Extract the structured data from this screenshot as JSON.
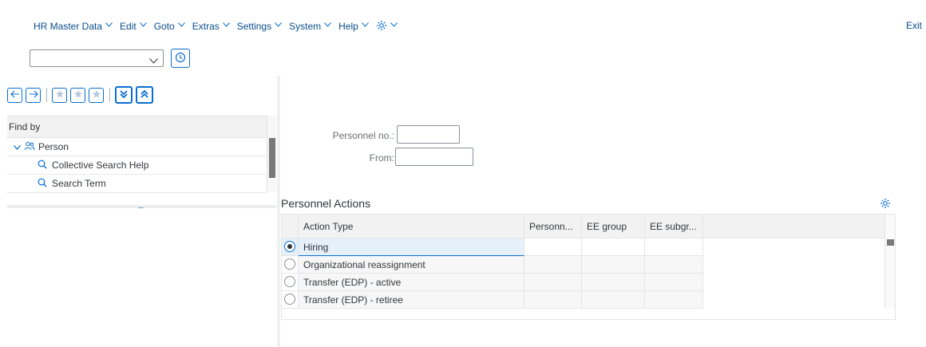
{
  "menubar": {
    "items": [
      "HR Master Data",
      "Edit",
      "Goto",
      "Extras",
      "Settings",
      "System",
      "Help"
    ],
    "settings_icon": "gear-icon",
    "exit_label": "Exit"
  },
  "command_field": {
    "value": "",
    "button_icon": "history-icon"
  },
  "toolbar": {
    "icons": [
      "arrow-left-icon",
      "arrow-right-icon",
      "star-add-icon",
      "star-icon",
      "star-remove-icon",
      "expand-all-icon",
      "collapse-all-icon"
    ]
  },
  "tree": {
    "header": "Find by",
    "items": [
      {
        "label": "Person",
        "icon": "people-icon",
        "expanded": true
      },
      {
        "label": "Collective Search Help",
        "icon": "search-icon"
      },
      {
        "label": "Search Term",
        "icon": "search-icon"
      }
    ],
    "splitter_dots": "....."
  },
  "form": {
    "personnel_no_label": "Personnel no.:",
    "personnel_no_value": "",
    "from_label": "From:",
    "from_value": ""
  },
  "actions": {
    "title": "Personnel Actions",
    "columns": [
      "Action Type",
      "Personn...",
      "EE group",
      "EE subgr..."
    ],
    "rows": [
      {
        "action": "Hiring",
        "selected": true
      },
      {
        "action": "Organizational reassignment",
        "selected": false
      },
      {
        "action": "Transfer (EDP) - active",
        "selected": false
      },
      {
        "action": "Transfer (EDP) - retiree",
        "selected": false
      }
    ]
  },
  "colors": {
    "accent": "#0a6ed1",
    "selected_row": "#e5f0fa",
    "header_bg": "#f2f2f2"
  }
}
